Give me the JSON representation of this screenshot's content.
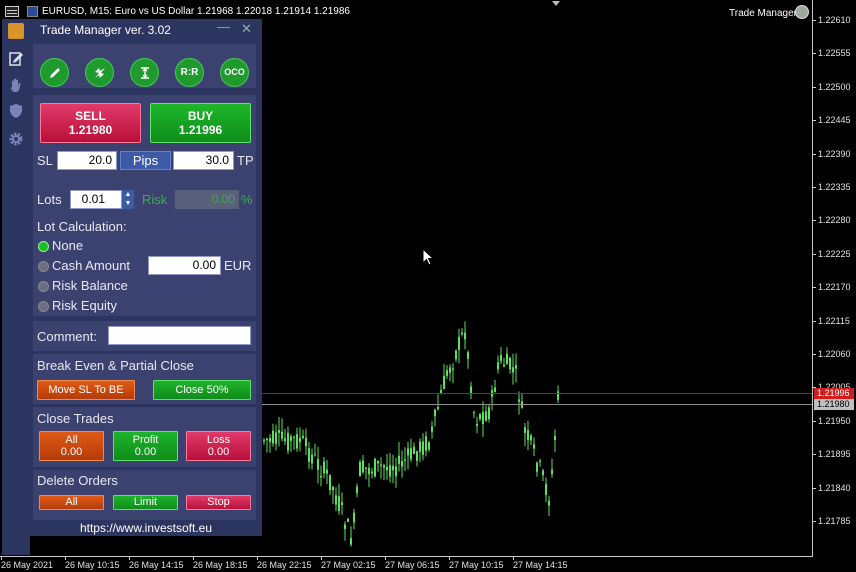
{
  "chart_header": {
    "title": "EURUSD, M15:  Euro vs US Dollar  1.21968 1.22018 1.21914 1.21986",
    "badge": "Trade Manager"
  },
  "price_axis": [
    "1.22610",
    "1.22555",
    "1.22500",
    "1.22445",
    "1.22390",
    "1.22335",
    "1.22280",
    "1.22225",
    "1.22170",
    "1.22115",
    "1.22060",
    "1.22005",
    "1.21950",
    "1.21895",
    "1.21840",
    "1.21785"
  ],
  "ask_price": "1.21996",
  "bid_price": "1.21980",
  "time_axis": [
    "26 May 2021",
    "26 May 10:15",
    "26 May 14:15",
    "26 May 18:15",
    "26 May 22:15",
    "27 May 02:15",
    "27 May 06:15",
    "27 May 10:15",
    "27 May 14:15"
  ],
  "colors": {
    "candle": "#5ee15e",
    "ask_line": "#b01818",
    "panel_bg": "#2c3560",
    "section_bg": "#3c4270",
    "accent_green": "#1f9b2e"
  },
  "panel": {
    "title": "Trade Manager ver. 3.02",
    "tools": [
      {
        "name": "pencil-icon"
      },
      {
        "name": "swap-arrows-icon"
      },
      {
        "name": "vertical-range-icon"
      },
      {
        "name": "risk-reward",
        "label": "R:R"
      },
      {
        "name": "oco",
        "label": "OCO"
      }
    ],
    "sell": {
      "label": "SELL",
      "price": "1.21980"
    },
    "buy": {
      "label": "BUY",
      "price": "1.21996"
    },
    "sl_label": "SL",
    "sl_value": "20.0",
    "pips_label": "Pips",
    "tp_value": "30.0",
    "tp_label": "TP",
    "lots_label": "Lots",
    "lots_value": "0.01",
    "risk_label": "Risk",
    "risk_value": "0.00",
    "risk_unit": "%",
    "lotcalc_title": "Lot Calculation:",
    "lotcalc_options": [
      "None",
      "Cash Amount",
      "Risk Balance",
      "Risk Equity"
    ],
    "cash_value": "0.00",
    "currency": "EUR",
    "comment_label": "Comment:",
    "comment_value": "",
    "be_title": "Break Even & Partial Close",
    "move_sl_label": "Move SL To BE",
    "close50_label": "Close 50%",
    "close_trades_title": "Close Trades",
    "close_all": {
      "label": "All",
      "value": "0.00"
    },
    "close_profit": {
      "label": "Profit",
      "value": "0.00"
    },
    "close_loss": {
      "label": "Loss",
      "value": "0.00"
    },
    "delete_orders_title": "Delete Orders",
    "del_all": "All",
    "del_limit": "Limit",
    "del_stop": "Stop",
    "url": "https://www.investsoft.eu"
  }
}
